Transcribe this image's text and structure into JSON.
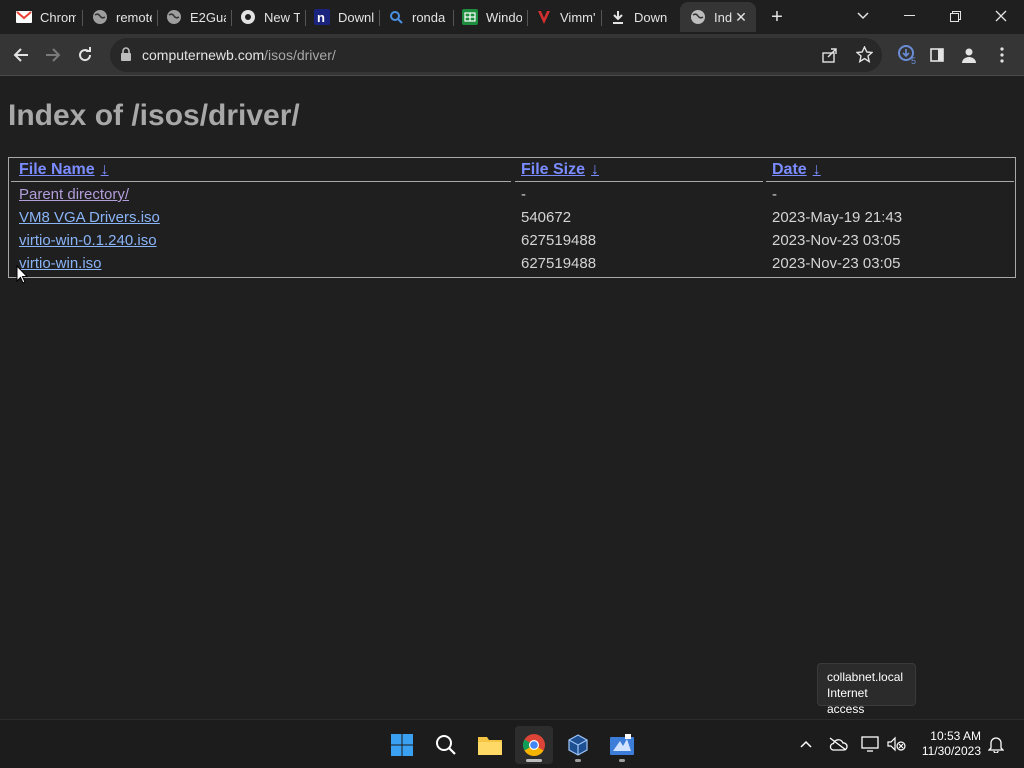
{
  "browser": {
    "tabs": [
      {
        "title": "Chrom",
        "icon": "gmail-icon"
      },
      {
        "title": "remote",
        "icon": "globe-icon"
      },
      {
        "title": "E2Gua",
        "icon": "globe-icon"
      },
      {
        "title": "New T",
        "icon": "chrome-icon"
      },
      {
        "title": "Downl",
        "icon": "n-icon"
      },
      {
        "title": "ronda",
        "icon": "search-icon"
      },
      {
        "title": "Windo",
        "icon": "sheets-icon"
      },
      {
        "title": "Vimm'",
        "icon": "vimm-icon"
      },
      {
        "title": "Down",
        "icon": "download-icon"
      },
      {
        "title": "Ind",
        "icon": "globe-icon",
        "active": true
      }
    ],
    "url_domain": "computernewb.com",
    "url_path": "/isos/driver/",
    "downloads_count": "5"
  },
  "page": {
    "title": "Index of /isos/driver/",
    "headers": {
      "name": "File Name",
      "size": "File Size",
      "date": "Date",
      "sort_arrow": "↓"
    },
    "rows": [
      {
        "name": "Parent directory/",
        "size": "-",
        "date": "-"
      },
      {
        "name": "VM8 VGA Drivers.iso",
        "size": "540672",
        "date": "2023-May-19 21:43"
      },
      {
        "name": "virtio-win-0.1.240.iso",
        "size": "627519488",
        "date": "2023-Nov-23 03:05"
      },
      {
        "name": "virtio-win.iso",
        "size": "627519488",
        "date": "2023-Nov-23 03:05"
      }
    ]
  },
  "tooltip": {
    "line1": "collabnet.local",
    "line2": "Internet access"
  },
  "taskbar": {
    "time": "10:53 AM",
    "date": "11/30/2023"
  },
  "colors": {
    "link": "#8ab4f8",
    "visited": "#b39ddb",
    "header_link": "#7a8cff"
  }
}
